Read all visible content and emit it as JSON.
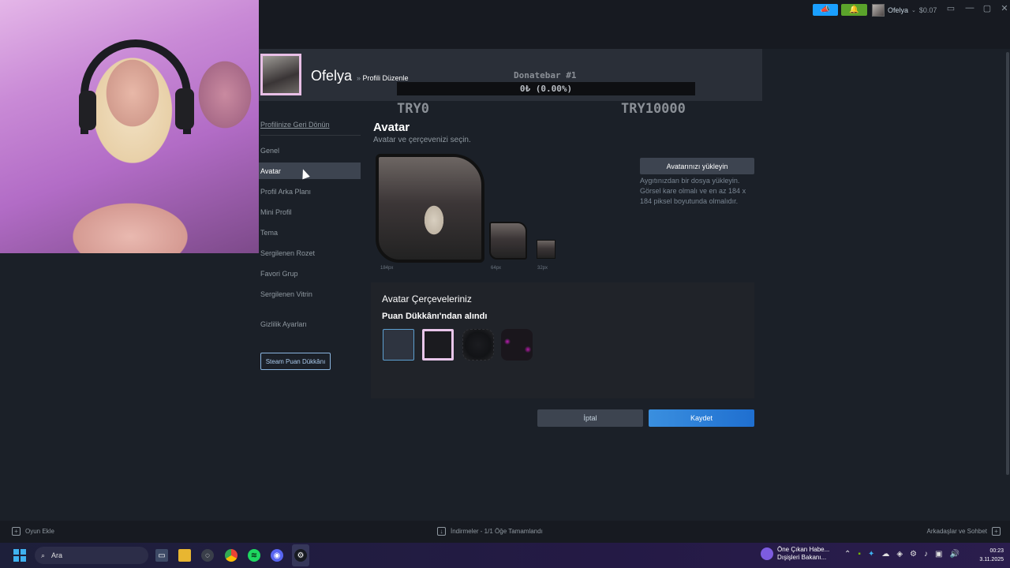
{
  "topbar": {
    "user_name": "Ofelya",
    "balance": "$0.07",
    "announce_icon": "megaphone-icon",
    "notify_icon": "bell-icon",
    "window_controls": [
      "▭",
      "—",
      "▢",
      "✕"
    ]
  },
  "profile": {
    "name": "Ofelya",
    "crumb_sep": "»",
    "crumb": "Profili Düzenle"
  },
  "donation": {
    "title": "Donatebar #1",
    "progress_text": "0₺ (0.00%)",
    "progress": 0,
    "min": "TRY0",
    "max": "TRY10000"
  },
  "sidebar": {
    "back_link": "Profilinize Geri Dönün",
    "items": [
      {
        "label": "Genel"
      },
      {
        "label": "Avatar"
      },
      {
        "label": "Profil Arka Planı"
      },
      {
        "label": "Mini Profil"
      },
      {
        "label": "Tema"
      },
      {
        "label": "Sergilenen Rozet"
      },
      {
        "label": "Favori Grup"
      },
      {
        "label": "Sergilenen Vitrin"
      },
      {
        "label": "Gizlilik Ayarları"
      }
    ],
    "active": "Avatar",
    "points_button": "Steam Puan Dükkânı"
  },
  "avatar_section": {
    "title": "Avatar",
    "subtitle": "Avatar ve çerçevenizi seçin.",
    "size_labels": [
      "184px",
      "64px",
      "32px"
    ],
    "upload_button": "Avatarınızı yükleyin",
    "upload_help": "Aygıtınızdan bir dosya yükleyin. Görsel kare olmalı ve en az 184 x 184 piksel boyutunda olmalıdır."
  },
  "frames": {
    "title": "Avatar Çerçeveleriniz",
    "subtitle": "Puan Dükkânı'ndan alındı"
  },
  "actions": {
    "cancel": "İptal",
    "save": "Kaydet"
  },
  "bottombar": {
    "add_game": "Oyun Ekle",
    "downloads": "İndirmeler - 1/1 Öğe Tamamlandı",
    "friends": "Arkadaşlar ve Sohbet"
  },
  "taskbar": {
    "search": "Ara",
    "news_line1": "Öne Çıkan Habe...",
    "news_line2": "Dışişleri Bakanı...",
    "time": "00:23",
    "date": "3.11.2025"
  },
  "colors": {
    "accent": "#1a9fff",
    "save": "#2f84da",
    "active_item": "#3d4450"
  }
}
